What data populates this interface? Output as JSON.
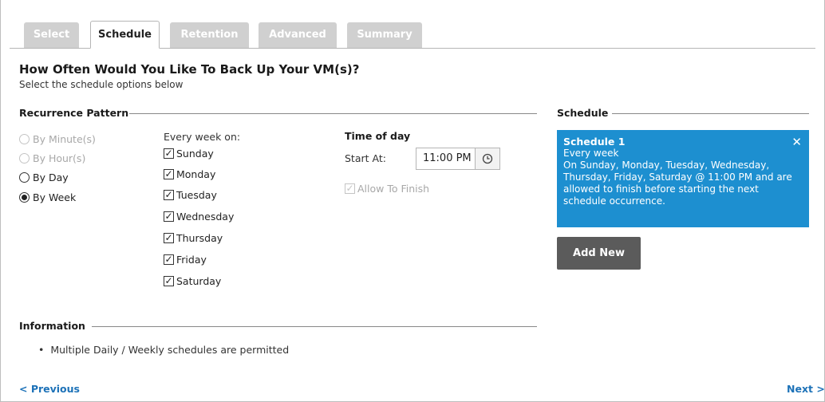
{
  "tabs": [
    {
      "label": "Select",
      "active": false
    },
    {
      "label": "Schedule",
      "active": true
    },
    {
      "label": "Retention",
      "active": false
    },
    {
      "label": "Advanced",
      "active": false
    },
    {
      "label": "Summary",
      "active": false
    }
  ],
  "page": {
    "title": "How Often Would You Like To Back Up Your VM(s)?",
    "subtitle": "Select the schedule options below"
  },
  "recurrence": {
    "section_title": "Recurrence Pattern",
    "options": [
      {
        "label": "By Minute(s)",
        "enabled": false,
        "checked": false
      },
      {
        "label": "By Hour(s)",
        "enabled": false,
        "checked": false
      },
      {
        "label": "By Day",
        "enabled": true,
        "checked": false
      },
      {
        "label": "By Week",
        "enabled": true,
        "checked": true
      }
    ],
    "week_label": "Every week on:",
    "days": [
      {
        "label": "Sunday",
        "checked": true
      },
      {
        "label": "Monday",
        "checked": true
      },
      {
        "label": "Tuesday",
        "checked": true
      },
      {
        "label": "Wednesday",
        "checked": true
      },
      {
        "label": "Thursday",
        "checked": true
      },
      {
        "label": "Friday",
        "checked": true
      },
      {
        "label": "Saturday",
        "checked": true
      }
    ]
  },
  "time_of_day": {
    "title": "Time of day",
    "start_label": "Start At:",
    "start_value": "11:00 PM",
    "allow_finish_label": "Allow To Finish",
    "allow_finish_checked": true,
    "allow_finish_enabled": false
  },
  "schedule": {
    "section_title": "Schedule",
    "card": {
      "title": "Schedule 1",
      "line1": "Every week",
      "description": "On Sunday, Monday, Tuesday, Wednesday, Thursday, Friday, Saturday @ 11:00 PM and are allowed to finish before starting the next schedule occurrence.",
      "close_glyph": "✕"
    },
    "add_new_label": "Add New"
  },
  "information": {
    "section_title": "Information",
    "items": [
      "Multiple Daily / Weekly schedules are permitted"
    ]
  },
  "nav": {
    "previous_label": "< Previous",
    "next_label": "Next >"
  },
  "colors": {
    "accent": "#1d8fd0",
    "link": "#1d72b8",
    "button": "#5b5b5b",
    "tab_inactive": "#d0d0d0"
  },
  "icons": {
    "clock": "clock-icon",
    "check": "checkmark-icon",
    "close": "close-icon"
  }
}
